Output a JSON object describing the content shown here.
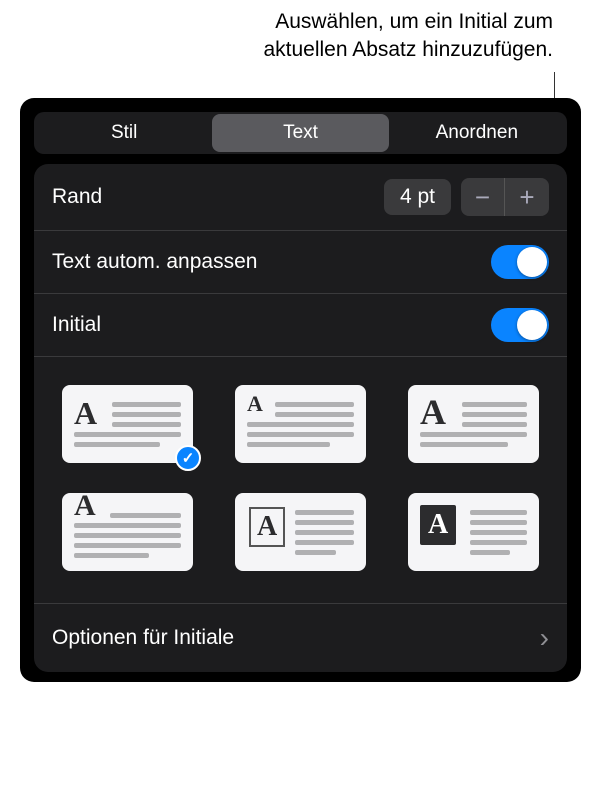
{
  "callout": {
    "line1": "Auswählen, um ein Initial zum",
    "line2": "aktuellen Absatz hinzuzufügen."
  },
  "tabs": {
    "stil": "Stil",
    "text": "Text",
    "anordnen": "Anordnen"
  },
  "rows": {
    "rand_label": "Rand",
    "rand_value": "4 pt",
    "autofit_label": "Text autom. anpassen",
    "initial_label": "Initial",
    "options_label": "Optionen für Initiale"
  },
  "dropcap": {
    "letter": "A",
    "selected_index": 0
  },
  "icons": {
    "minus": "−",
    "plus": "+",
    "chevron": "›",
    "check": "✓"
  }
}
